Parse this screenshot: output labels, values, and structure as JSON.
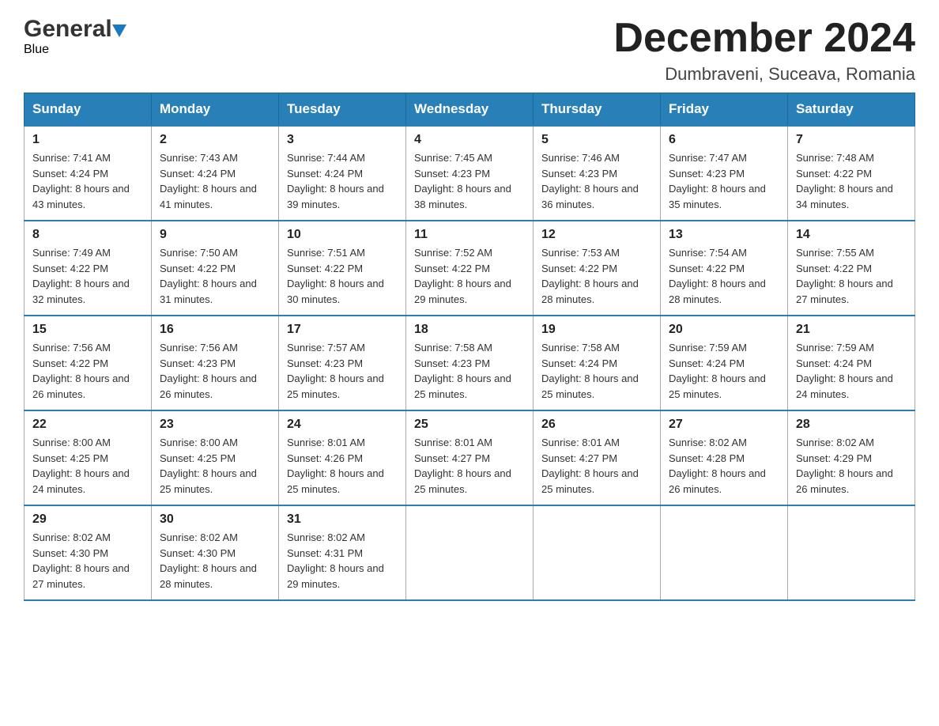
{
  "header": {
    "logo_general": "General",
    "logo_blue": "Blue",
    "title": "December 2024",
    "location": "Dumbraveni, Suceava, Romania"
  },
  "days_of_week": [
    "Sunday",
    "Monday",
    "Tuesday",
    "Wednesday",
    "Thursday",
    "Friday",
    "Saturday"
  ],
  "weeks": [
    [
      {
        "num": "1",
        "sunrise": "Sunrise: 7:41 AM",
        "sunset": "Sunset: 4:24 PM",
        "daylight": "Daylight: 8 hours and 43 minutes."
      },
      {
        "num": "2",
        "sunrise": "Sunrise: 7:43 AM",
        "sunset": "Sunset: 4:24 PM",
        "daylight": "Daylight: 8 hours and 41 minutes."
      },
      {
        "num": "3",
        "sunrise": "Sunrise: 7:44 AM",
        "sunset": "Sunset: 4:24 PM",
        "daylight": "Daylight: 8 hours and 39 minutes."
      },
      {
        "num": "4",
        "sunrise": "Sunrise: 7:45 AM",
        "sunset": "Sunset: 4:23 PM",
        "daylight": "Daylight: 8 hours and 38 minutes."
      },
      {
        "num": "5",
        "sunrise": "Sunrise: 7:46 AM",
        "sunset": "Sunset: 4:23 PM",
        "daylight": "Daylight: 8 hours and 36 minutes."
      },
      {
        "num": "6",
        "sunrise": "Sunrise: 7:47 AM",
        "sunset": "Sunset: 4:23 PM",
        "daylight": "Daylight: 8 hours and 35 minutes."
      },
      {
        "num": "7",
        "sunrise": "Sunrise: 7:48 AM",
        "sunset": "Sunset: 4:22 PM",
        "daylight": "Daylight: 8 hours and 34 minutes."
      }
    ],
    [
      {
        "num": "8",
        "sunrise": "Sunrise: 7:49 AM",
        "sunset": "Sunset: 4:22 PM",
        "daylight": "Daylight: 8 hours and 32 minutes."
      },
      {
        "num": "9",
        "sunrise": "Sunrise: 7:50 AM",
        "sunset": "Sunset: 4:22 PM",
        "daylight": "Daylight: 8 hours and 31 minutes."
      },
      {
        "num": "10",
        "sunrise": "Sunrise: 7:51 AM",
        "sunset": "Sunset: 4:22 PM",
        "daylight": "Daylight: 8 hours and 30 minutes."
      },
      {
        "num": "11",
        "sunrise": "Sunrise: 7:52 AM",
        "sunset": "Sunset: 4:22 PM",
        "daylight": "Daylight: 8 hours and 29 minutes."
      },
      {
        "num": "12",
        "sunrise": "Sunrise: 7:53 AM",
        "sunset": "Sunset: 4:22 PM",
        "daylight": "Daylight: 8 hours and 28 minutes."
      },
      {
        "num": "13",
        "sunrise": "Sunrise: 7:54 AM",
        "sunset": "Sunset: 4:22 PM",
        "daylight": "Daylight: 8 hours and 28 minutes."
      },
      {
        "num": "14",
        "sunrise": "Sunrise: 7:55 AM",
        "sunset": "Sunset: 4:22 PM",
        "daylight": "Daylight: 8 hours and 27 minutes."
      }
    ],
    [
      {
        "num": "15",
        "sunrise": "Sunrise: 7:56 AM",
        "sunset": "Sunset: 4:22 PM",
        "daylight": "Daylight: 8 hours and 26 minutes."
      },
      {
        "num": "16",
        "sunrise": "Sunrise: 7:56 AM",
        "sunset": "Sunset: 4:23 PM",
        "daylight": "Daylight: 8 hours and 26 minutes."
      },
      {
        "num": "17",
        "sunrise": "Sunrise: 7:57 AM",
        "sunset": "Sunset: 4:23 PM",
        "daylight": "Daylight: 8 hours and 25 minutes."
      },
      {
        "num": "18",
        "sunrise": "Sunrise: 7:58 AM",
        "sunset": "Sunset: 4:23 PM",
        "daylight": "Daylight: 8 hours and 25 minutes."
      },
      {
        "num": "19",
        "sunrise": "Sunrise: 7:58 AM",
        "sunset": "Sunset: 4:24 PM",
        "daylight": "Daylight: 8 hours and 25 minutes."
      },
      {
        "num": "20",
        "sunrise": "Sunrise: 7:59 AM",
        "sunset": "Sunset: 4:24 PM",
        "daylight": "Daylight: 8 hours and 25 minutes."
      },
      {
        "num": "21",
        "sunrise": "Sunrise: 7:59 AM",
        "sunset": "Sunset: 4:24 PM",
        "daylight": "Daylight: 8 hours and 24 minutes."
      }
    ],
    [
      {
        "num": "22",
        "sunrise": "Sunrise: 8:00 AM",
        "sunset": "Sunset: 4:25 PM",
        "daylight": "Daylight: 8 hours and 24 minutes."
      },
      {
        "num": "23",
        "sunrise": "Sunrise: 8:00 AM",
        "sunset": "Sunset: 4:25 PM",
        "daylight": "Daylight: 8 hours and 25 minutes."
      },
      {
        "num": "24",
        "sunrise": "Sunrise: 8:01 AM",
        "sunset": "Sunset: 4:26 PM",
        "daylight": "Daylight: 8 hours and 25 minutes."
      },
      {
        "num": "25",
        "sunrise": "Sunrise: 8:01 AM",
        "sunset": "Sunset: 4:27 PM",
        "daylight": "Daylight: 8 hours and 25 minutes."
      },
      {
        "num": "26",
        "sunrise": "Sunrise: 8:01 AM",
        "sunset": "Sunset: 4:27 PM",
        "daylight": "Daylight: 8 hours and 25 minutes."
      },
      {
        "num": "27",
        "sunrise": "Sunrise: 8:02 AM",
        "sunset": "Sunset: 4:28 PM",
        "daylight": "Daylight: 8 hours and 26 minutes."
      },
      {
        "num": "28",
        "sunrise": "Sunrise: 8:02 AM",
        "sunset": "Sunset: 4:29 PM",
        "daylight": "Daylight: 8 hours and 26 minutes."
      }
    ],
    [
      {
        "num": "29",
        "sunrise": "Sunrise: 8:02 AM",
        "sunset": "Sunset: 4:30 PM",
        "daylight": "Daylight: 8 hours and 27 minutes."
      },
      {
        "num": "30",
        "sunrise": "Sunrise: 8:02 AM",
        "sunset": "Sunset: 4:30 PM",
        "daylight": "Daylight: 8 hours and 28 minutes."
      },
      {
        "num": "31",
        "sunrise": "Sunrise: 8:02 AM",
        "sunset": "Sunset: 4:31 PM",
        "daylight": "Daylight: 8 hours and 29 minutes."
      },
      null,
      null,
      null,
      null
    ]
  ]
}
